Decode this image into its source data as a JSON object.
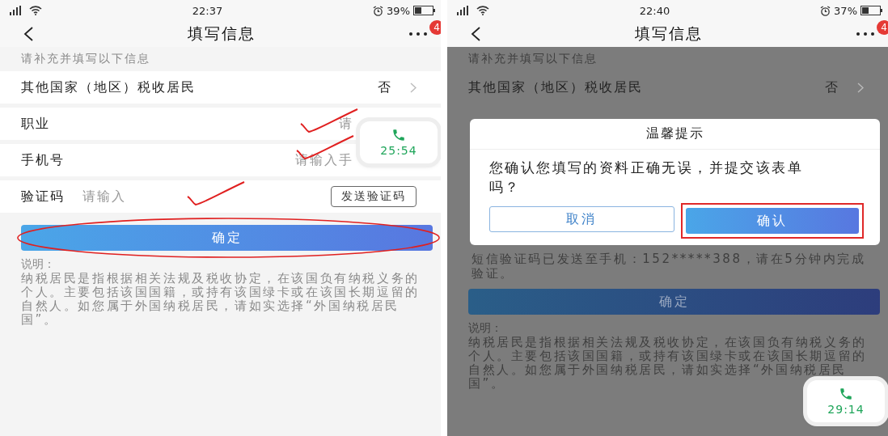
{
  "screens": [
    {
      "status_bar": {
        "time": "22:37",
        "battery": "39%"
      },
      "nav": {
        "title": "填写信息",
        "badge": "4"
      },
      "hint": "请补充并填写以下信息",
      "dimmed": false,
      "rows": [
        {
          "kind": "select",
          "label": "其他国家（地区）税收居民",
          "value": "否",
          "marked": false
        },
        {
          "kind": "input",
          "label": "职业",
          "placeholder": "请",
          "marked": true
        },
        {
          "kind": "input",
          "label": "手机号",
          "placeholder": "请输入手",
          "marked": true
        },
        {
          "kind": "code",
          "label": "验证码",
          "placeholder": "请输入",
          "button": "发送验证码",
          "marked": true
        }
      ],
      "submit": {
        "label": "确定",
        "circled": true
      },
      "note_title": "说明：",
      "note": "纳税居民是指根据相关法规及税收协定，在该国负有纳税义务的个人。主要包括该国国籍，或持有该国绿卡或在该国长期逗留的自然人。如您属于外国纳税居民，请如实选择“外国纳税居民国”。",
      "call": {
        "time": "25:54"
      }
    },
    {
      "status_bar": {
        "time": "22:40",
        "battery": "37%"
      },
      "nav": {
        "title": "填写信息",
        "badge": "4"
      },
      "hint": "请补充并填写以下信息",
      "dimmed": true,
      "rows": [
        {
          "kind": "select",
          "label": "其他国家（地区）税收居民",
          "value": "否",
          "marked": false
        }
      ],
      "dialog": {
        "title": "温馨提示",
        "message": "您确认您填写的资料正确无误，并提交该表单吗？",
        "cancel": "取消",
        "confirm": "确认",
        "confirm_highlighted": true
      },
      "sms_notice": "短信验证码已发送至手机：152*****388，请在5分钟内完成验证。",
      "submit": {
        "label": "确定",
        "circled": false
      },
      "note_title": "说明：",
      "note": "纳税居民是指根据相关法规及税收协定，在该国负有纳税义务的个人。主要包括该国国籍，或持有该国绿卡或在该国长期逗留的自然人。如您属于外国纳税居民，请如实选择“外国纳税居民国”。",
      "call": {
        "time": "29:14"
      }
    }
  ]
}
